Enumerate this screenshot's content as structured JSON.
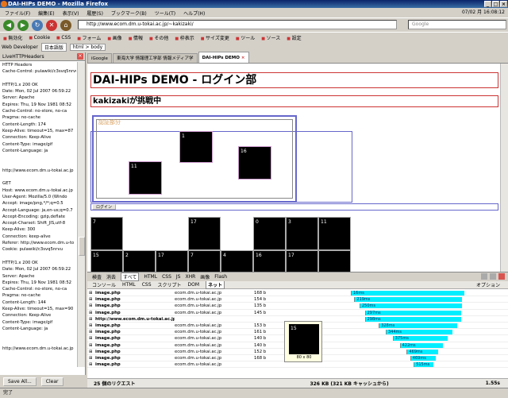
{
  "window": {
    "title": "DAI-HIPs DEMO - Mozilla Firefox"
  },
  "menubar": {
    "items": [
      "ファイル(F)",
      "編集(E)",
      "表示(V)",
      "履歴(S)",
      "ブックマーク(B)",
      "ツール(T)",
      "ヘルプ(H)"
    ],
    "clock": "07/02 月 16:08:12"
  },
  "navbar": {
    "url": "http://www.ecom.dm.u-tokai.ac.jp/~kakizaki/",
    "search_placeholder": "Google"
  },
  "toolbar_webdev": {
    "items": [
      "無効化",
      "Cookie",
      "CSS",
      "フォーム",
      "画像",
      "情報",
      "その他",
      "枠表示",
      "サイズ変更",
      "ツール",
      "ソース",
      "設定"
    ]
  },
  "toolbar_breadcrumb": {
    "label": "Web Developer",
    "crumbs": [
      "日本語版",
      "html > body"
    ]
  },
  "sidebar": {
    "title": "LiveHTTPHeaders",
    "lines": [
      "HTTP Headers",
      "Cache-Control: pulawiki/c3svq5nrvu",
      "",
      "HTTP/1.x 200 OK",
      "Date: Mon, 02 Jul 2007 06:59:22",
      "Server: Apache",
      "Expires: Thu, 19 Nov 1981 08:52",
      "Cache-Control: no-store, no-ca",
      "Pragma: no-cache",
      "Content-Length: 174",
      "Keep-Alive: timeout=15, max=87",
      "Connection: Keep-Alive",
      "Content-Type: image/gif",
      "Content-Language: ja",
      "",
      "",
      "http://www.ecom.dm.u-tokai.ac.jp",
      "",
      "GET",
      "Host: www.ecom.dm.u-tokai.ac.jp",
      "User-Agent: Mozilla/5.0 (Windo",
      "Accept: image/png,*/*;q=0.5",
      "Accept-Language: ja,en-us;q=0.7",
      "Accept-Encoding: gzip,deflate",
      "Accept-Charset: Shift_JIS,utf-8",
      "Keep-Alive: 300",
      "Connection: keep-alive",
      "Referer: http://www.ecom.dm.u-to",
      "Cookie: pulawiki/c3svq5nrvu",
      "",
      "HTTP/1.x 200 OK",
      "Date: Mon, 02 Jul 2007 06:59:22",
      "Server: Apache",
      "Expires: Thu, 19 Nov 1981 08:52",
      "Cache-Control: no-store, no-ca",
      "Pragma: no-cache",
      "Content-Length: 144",
      "Keep-Alive: timeout=15, max=90",
      "Connection: Keep-Alive",
      "Content-Type: image/gif",
      "Content-Language: ja",
      "",
      "",
      "http://www.ecom.dm.u-tokai.ac.jp"
    ],
    "save_label": "Save All...",
    "clear_label": "Clear"
  },
  "tabs": [
    {
      "label": "iGoogle"
    },
    {
      "label": "東海大学 情報理工学部 情報メディア学"
    },
    {
      "label": "DAI-HIPs DEMO"
    }
  ],
  "page": {
    "heading": "DAI-HIPs DEMO - ログイン部",
    "subheading": "kakizakiが挑戦中",
    "auth_label": "認証部分",
    "login_label": "ログイン",
    "tiles": [
      "11",
      "1",
      "16"
    ],
    "grid_row1": [
      "7",
      "",
      "",
      "17",
      "",
      "0",
      "3",
      "11"
    ],
    "grid_row2": [
      "15",
      "2",
      "17",
      "7",
      "4",
      "16",
      "17",
      ""
    ]
  },
  "firebug": {
    "top_tabs": [
      "検査",
      "消去",
      "すべて",
      "HTML",
      "CSS",
      "JS",
      "XHR",
      "画像",
      "Flash"
    ],
    "selected_top": "すべて",
    "sub_tabs": [
      "コンソール",
      "HTML",
      "CSS",
      "スクリプト",
      "DOM",
      "ネット"
    ],
    "selected_sub": "ネット",
    "options_label": "オプション",
    "rows": [
      {
        "name": "image.php",
        "domain": "ecom.dm.u-tokai.ac.jp",
        "size": "168 b",
        "time": "16ms",
        "offset": 0.1,
        "len": 0.82
      },
      {
        "name": "image.php",
        "domain": "ecom.dm.u-tokai.ac.jp",
        "size": "154 b",
        "time": "219ms",
        "offset": 0.12,
        "len": 0.8
      },
      {
        "name": "image.php",
        "domain": "ecom.dm.u-tokai.ac.jp",
        "size": "135 b",
        "time": "250ms",
        "offset": 0.15,
        "len": 0.78
      },
      {
        "name": "image.php",
        "domain": "ecom.dm.u-tokai.ac.jp",
        "size": "145 b",
        "time": "297ms",
        "offset": 0.18,
        "len": 0.76
      },
      {
        "name": "http://www.ecom.dm.u-tokai.ac.jp/~kakizaki",
        "domain": "",
        "size": "",
        "time": "298ms",
        "offset": 0.18,
        "len": 0.76
      },
      {
        "name": "image.php",
        "domain": "ecom.dm.u-tokai.ac.jp",
        "size": "153 b",
        "time": "328ms",
        "offset": 0.26,
        "len": 0.7
      },
      {
        "name": "image.php",
        "domain": "ecom.dm.u-tokai.ac.jp",
        "size": "161 b",
        "time": "344ms",
        "offset": 0.3,
        "len": 0.66
      },
      {
        "name": "image.php",
        "domain": "ecom.dm.u-tokai.ac.jp",
        "size": "140 b",
        "time": "375ms",
        "offset": 0.34,
        "len": 0.62
      },
      {
        "name": "image.php",
        "domain": "ecom.dm.u-tokai.ac.jp",
        "size": "140 b",
        "time": "422ms",
        "offset": 0.38,
        "len": 0.58
      },
      {
        "name": "image.php",
        "domain": "ecom.dm.u-tokai.ac.jp",
        "size": "152 b",
        "time": "469ms",
        "offset": 0.42,
        "len": 0.54
      },
      {
        "name": "image.php",
        "domain": "ecom.dm.u-tokai.ac.jp",
        "size": "168 b",
        "time": "469ms",
        "offset": 0.44,
        "len": 0.52
      },
      {
        "name": "image.php",
        "domain": "ecom.dm.u-tokai.ac.jp",
        "size": "",
        "time": "515ms",
        "offset": 0.46,
        "len": 0.5
      }
    ],
    "tooltip_value": "15",
    "tooltip_caption": "80 x 80",
    "footer_requests": "25 個のリクエスト",
    "footer_size": "326 KB (321 KB キャッシュから)",
    "footer_time": "1.55s"
  },
  "status": {
    "text": "完了"
  },
  "colors": {
    "accent": "#0a246a",
    "bar": "#00eeff"
  }
}
